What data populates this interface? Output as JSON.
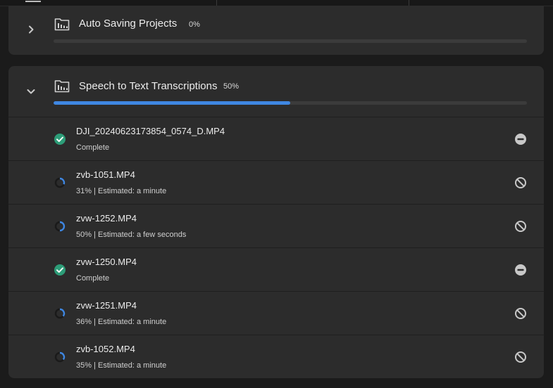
{
  "auto_saving": {
    "title": "Auto Saving Projects",
    "percent_label": "0%",
    "progress": 0.0,
    "collapsed": true
  },
  "speech": {
    "title": "Speech to Text Transcriptions",
    "percent_label": "50%",
    "progress": 0.5,
    "collapsed": false,
    "items": [
      {
        "name": "DJI_20240623173854_0574_D.MP4",
        "status_text": "Complete",
        "state": "complete",
        "progress": 1.0
      },
      {
        "name": "zvb-1051.MP4",
        "status_text": "31% | Estimated: a minute",
        "state": "in-progress",
        "progress": 0.31
      },
      {
        "name": "zvw-1252.MP4",
        "status_text": "50% | Estimated: a few seconds",
        "state": "in-progress",
        "progress": 0.5
      },
      {
        "name": "zvw-1250.MP4",
        "status_text": "Complete",
        "state": "complete",
        "progress": 1.0
      },
      {
        "name": "zvw-1251.MP4",
        "status_text": "36% | Estimated: a minute",
        "state": "in-progress",
        "progress": 0.36
      },
      {
        "name": "zvb-1052.MP4",
        "status_text": "35% | Estimated: a minute",
        "state": "in-progress",
        "progress": 0.35
      }
    ]
  },
  "colors": {
    "accent": "#3f87e2",
    "complete": "#2d9d78",
    "icon": "#c8c8c8"
  }
}
